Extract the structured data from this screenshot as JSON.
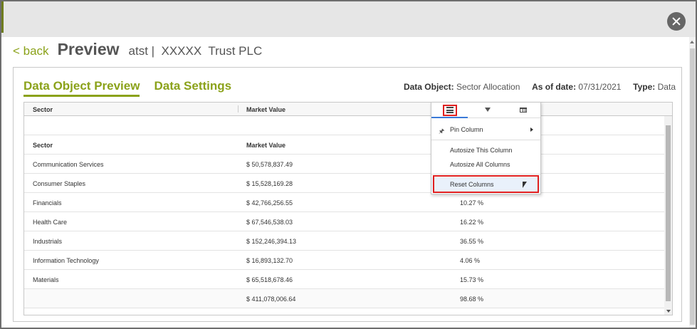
{
  "header": {
    "back_label": "< back",
    "title": "Preview",
    "subtitle": "atst |  XXXXX  Trust PLC"
  },
  "tabs": [
    {
      "label": "Data Object Preview",
      "active": true
    },
    {
      "label": "Data Settings",
      "active": false
    }
  ],
  "meta": {
    "data_object_label": "Data Object:",
    "data_object_value": "Sector Allocation",
    "as_of_label": "As of date:",
    "as_of_value": "07/31/2021",
    "type_label": "Type:",
    "type_value": "Data"
  },
  "grid": {
    "columns": [
      "Sector",
      "Market Value"
    ],
    "rows": [
      [
        "Sector",
        "Market Value",
        ""
      ],
      [
        "Communication Services",
        "$ 50,578,837.49",
        ""
      ],
      [
        "Consumer Staples",
        "$ 15,528,169.28",
        ""
      ],
      [
        "Financials",
        "$ 42,766,256.55",
        "10.27 %"
      ],
      [
        "Health Care",
        "$ 67,546,538.03",
        "16.22 %"
      ],
      [
        "Industrials",
        "$ 152,246,394.13",
        "36.55 %"
      ],
      [
        "Information Technology",
        "$ 16,893,132.70",
        "4.06 %"
      ],
      [
        "Materials",
        "$ 65,518,678.46",
        "15.73 %"
      ],
      [
        "",
        "$ 411,078,006.64",
        "98.68 %"
      ]
    ]
  },
  "column_menu": {
    "items": {
      "pin": "Pin Column",
      "autosize_this": "Autosize This Column",
      "autosize_all": "Autosize All Columns",
      "reset": "Reset Columns"
    }
  },
  "colors": {
    "accent": "#8ba21a",
    "highlight_outline": "#e02020",
    "active_tab_underline": "#3b7ad8"
  }
}
